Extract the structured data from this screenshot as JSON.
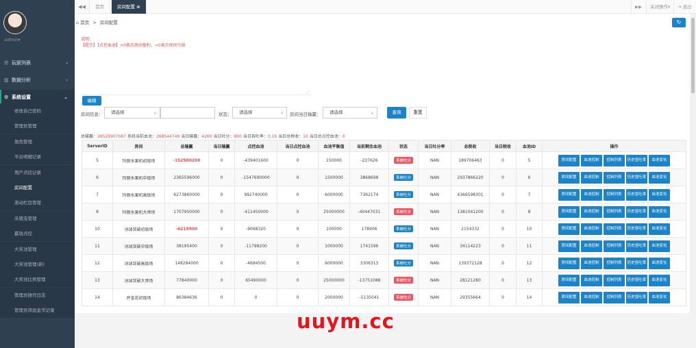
{
  "sidebar": {
    "user": "admin",
    "menus": [
      {
        "label": "玩家列表",
        "icon": "list-icon"
      },
      {
        "label": "数据分析",
        "icon": "chart-icon"
      },
      {
        "label": "系统设置",
        "icon": "gear-icon"
      }
    ],
    "sub_items": [
      "修改自己密码",
      "管理员管理",
      "角色管理",
      "平台明细记录",
      "用户点控记录",
      "房间配置",
      "滚动栏目管理",
      "杀猪虫管理",
      "赢钱点控",
      "大奖池管理",
      "大奖池管理(新)",
      "大奖池比例管理",
      "管理员操作日志",
      "管理员添加金币记录"
    ]
  },
  "topbar": {
    "back_glyph": "◀◀",
    "fwd_glyph": "▶▶",
    "tabs": [
      "首页",
      "房间配置"
    ],
    "close_ops": "关闭操作",
    "logout": "退出"
  },
  "breadcrumb": {
    "home": "首页",
    "sep": ">",
    "current": "房间配置"
  },
  "notes": {
    "title": "说明：",
    "line1": "【提示】【点控血池】>0表示房间盈利，<0表示房间亏损"
  },
  "edit_label": "编辑",
  "filters": {
    "room_info_label": "房间信息：",
    "room_info_value": "请选择",
    "status_label": "状态：",
    "status_value": "请选择",
    "input_label": "房间当日输赢：",
    "input_value": "请选择",
    "query_label": "查询",
    "reset_label": "重置"
  },
  "summary": {
    "total_label": "总输赢：",
    "total_value": "26529907087",
    "blood_label": "系统当前血池：",
    "blood_value": "268544749",
    "daily_label": "当日输赢：",
    "daily_value": "4200",
    "daily_turn_label": "当日吐分：",
    "daily_turn_value": "800",
    "daily_rate_label": "当日吞吐率：",
    "daily_rate_value": "0.16",
    "tax_label": "当日总税收：",
    "tax_value": "10",
    "ctrl_label": "当日总点控血池：",
    "ctrl_value": "0"
  },
  "table": {
    "headers": [
      "ServerID",
      "房间",
      "总输赢",
      "当日输赢",
      "点控血池",
      "当日点控血池",
      "血池平衡值",
      "当前剩余血池",
      "状态",
      "当日吐分率",
      "总税收",
      "当日税收",
      "血池ID",
      "操作"
    ],
    "ops": [
      "房间配置",
      "血池控制",
      "控制列表",
      "历史吞吐率",
      "血池变化"
    ],
    "rows": [
      {
        "id": "5",
        "room": "玛丽水果机初级场",
        "total": "-152500200",
        "daily": "0",
        "ctrl": "-439401600",
        "dctrl": "0",
        "balance": "150000",
        "remain": "-237626",
        "status": "系统吃分",
        "rate": "NAN",
        "tax": "189706463",
        "dtax": "0",
        "pool": "5"
      },
      {
        "id": "6",
        "room": "玛丽水果机中级场",
        "total": "2365596000",
        "daily": "0",
        "ctrl": "-1547690000",
        "dctrl": "0",
        "balance": "1500000",
        "remain": "3868698",
        "status": "系统吐分",
        "rate": "NAN",
        "tax": "2937866220",
        "dtax": "0",
        "pool": "6"
      },
      {
        "id": "7",
        "room": "玛丽水果机高级场",
        "total": "6273860000",
        "daily": "0",
        "ctrl": "992740000",
        "dctrl": "0",
        "balance": "6000000",
        "remain": "7362174",
        "status": "系统吐分",
        "rate": "NAN",
        "tax": "4366598301",
        "dtax": "0",
        "pool": "7"
      },
      {
        "id": "8",
        "room": "玛丽水果机大师场",
        "total": "1707950000",
        "daily": "0",
        "ctrl": "-411450000",
        "dctrl": "0",
        "balance": "25000000",
        "remain": "-40447031",
        "status": "系统吃分",
        "rate": "NAN",
        "tax": "1381041200",
        "dtax": "0",
        "pool": "8"
      },
      {
        "id": "10",
        "room": "冰球突破初级场",
        "total": "-6219900",
        "daily": "0",
        "ctrl": "-9068320",
        "dctrl": "0",
        "balance": "100000",
        "remain": "178906",
        "status": "系统吐分",
        "rate": "NAN",
        "tax": "2154332",
        "dtax": "0",
        "pool": "10"
      },
      {
        "id": "11",
        "room": "冰球突破中级场",
        "total": "38195400",
        "daily": "0",
        "ctrl": "-11798200",
        "dctrl": "0",
        "balance": "1000000",
        "remain": "1741596",
        "status": "系统吐分",
        "rate": "NAN",
        "tax": "34114223",
        "dtax": "0",
        "pool": "11"
      },
      {
        "id": "12",
        "room": "冰球突破高级场",
        "total": "148284000",
        "daily": "0",
        "ctrl": "-4684500",
        "dctrl": "0",
        "balance": "6000000",
        "remain": "3306313",
        "status": "系统吐分",
        "rate": "NAN",
        "tax": "139372128",
        "dtax": "0",
        "pool": "12"
      },
      {
        "id": "13",
        "room": "冰球突破大师场",
        "total": "77840000",
        "daily": "0",
        "ctrl": "65490000",
        "dctrl": "0",
        "balance": "25000000",
        "remain": "-13751088",
        "status": "系统吃分",
        "rate": "NAN",
        "tax": "28121280",
        "dtax": "0",
        "pool": "13"
      },
      {
        "id": "14",
        "room": "并金花初级场",
        "total": "86384636",
        "daily": "0",
        "ctrl": "0",
        "dctrl": "0",
        "balance": "2000000",
        "remain": "-5135041",
        "status": "系统吃分",
        "rate": "NAN",
        "tax": "29355664",
        "dtax": "0",
        "pool": "14"
      }
    ]
  },
  "watermark": "uuym.cc"
}
